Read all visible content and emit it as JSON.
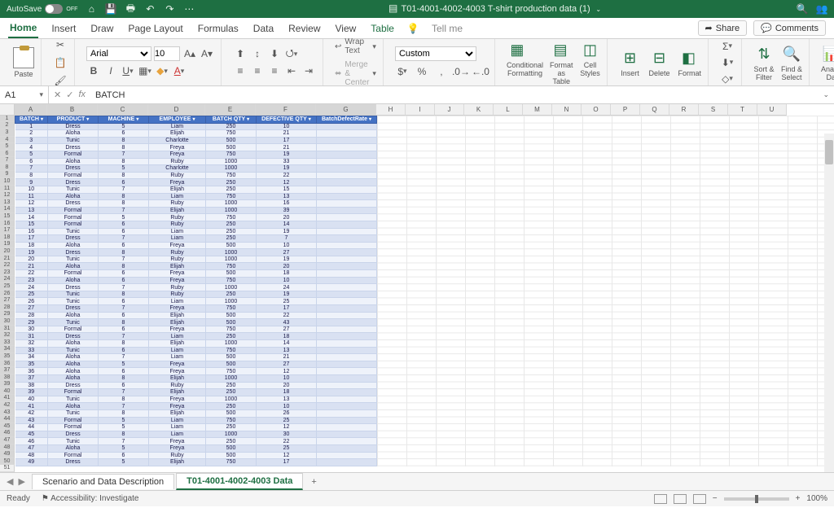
{
  "titlebar": {
    "autosave_label": "AutoSave",
    "autosave_state": "OFF",
    "filename": "T01-4001-4002-4003 T-shirt production data (1)"
  },
  "tabs": {
    "items": [
      "Home",
      "Insert",
      "Draw",
      "Page Layout",
      "Formulas",
      "Data",
      "Review",
      "View",
      "Table"
    ],
    "tell_me": "Tell me",
    "share": "Share",
    "comments": "Comments",
    "active": "Home"
  },
  "ribbon": {
    "paste": "Paste",
    "font_name": "Arial",
    "font_size": "10",
    "wrap_text": "Wrap Text",
    "merge_center": "Merge & Center",
    "number_format": "Custom",
    "cond_fmt": "Conditional Formatting",
    "fmt_table": "Format as Table",
    "cell_styles": "Cell Styles",
    "insert": "Insert",
    "delete": "Delete",
    "format": "Format",
    "sort_filter": "Sort & Filter",
    "find_select": "Find & Select",
    "analyze": "Analyze Data"
  },
  "formula_bar": {
    "name_box": "A1",
    "formula": "BATCH"
  },
  "columns": [
    "A",
    "B",
    "C",
    "D",
    "E",
    "F",
    "G",
    "H",
    "I",
    "J",
    "K",
    "L",
    "M",
    "N",
    "O",
    "P",
    "Q",
    "R",
    "S",
    "T",
    "U"
  ],
  "table": {
    "headers": [
      "BATCH",
      "PRODUCT",
      "MACHINE",
      "EMPLOYEE",
      "BATCH QTY",
      "DEFECTIVE QTY",
      "BatchDefectRate"
    ],
    "rows": [
      [
        1,
        "Dress",
        5,
        "Liam",
        250,
        10,
        ""
      ],
      [
        2,
        "Aloha",
        6,
        "Elijah",
        750,
        21,
        ""
      ],
      [
        3,
        "Tunic",
        8,
        "Charlotte",
        500,
        17,
        ""
      ],
      [
        4,
        "Dress",
        8,
        "Freya",
        500,
        21,
        ""
      ],
      [
        5,
        "Formal",
        7,
        "Freya",
        750,
        19,
        ""
      ],
      [
        6,
        "Aloha",
        8,
        "Ruby",
        1000,
        33,
        ""
      ],
      [
        7,
        "Dress",
        5,
        "Charlotte",
        1000,
        19,
        ""
      ],
      [
        8,
        "Formal",
        8,
        "Ruby",
        750,
        22,
        ""
      ],
      [
        9,
        "Dress",
        6,
        "Freya",
        250,
        12,
        ""
      ],
      [
        10,
        "Tunic",
        7,
        "Elijah",
        250,
        15,
        ""
      ],
      [
        11,
        "Aloha",
        8,
        "Liam",
        750,
        13,
        ""
      ],
      [
        12,
        "Dress",
        8,
        "Ruby",
        1000,
        16,
        ""
      ],
      [
        13,
        "Formal",
        7,
        "Elijah",
        1000,
        39,
        ""
      ],
      [
        14,
        "Formal",
        5,
        "Ruby",
        750,
        20,
        ""
      ],
      [
        15,
        "Formal",
        6,
        "Ruby",
        250,
        14,
        ""
      ],
      [
        16,
        "Tunic",
        6,
        "Liam",
        250,
        19,
        ""
      ],
      [
        17,
        "Dress",
        7,
        "Liam",
        250,
        7,
        ""
      ],
      [
        18,
        "Aloha",
        6,
        "Freya",
        500,
        10,
        ""
      ],
      [
        19,
        "Dress",
        8,
        "Ruby",
        1000,
        27,
        ""
      ],
      [
        20,
        "Tunic",
        7,
        "Ruby",
        1000,
        19,
        ""
      ],
      [
        21,
        "Aloha",
        8,
        "Elijah",
        750,
        20,
        ""
      ],
      [
        22,
        "Formal",
        6,
        "Freya",
        500,
        18,
        ""
      ],
      [
        23,
        "Aloha",
        6,
        "Freya",
        750,
        10,
        ""
      ],
      [
        24,
        "Dress",
        7,
        "Ruby",
        1000,
        24,
        ""
      ],
      [
        25,
        "Tunic",
        8,
        "Ruby",
        250,
        19,
        ""
      ],
      [
        26,
        "Tunic",
        6,
        "Liam",
        1000,
        25,
        ""
      ],
      [
        27,
        "Dress",
        7,
        "Freya",
        750,
        17,
        ""
      ],
      [
        28,
        "Aloha",
        6,
        "Elijah",
        500,
        22,
        ""
      ],
      [
        29,
        "Tunic",
        8,
        "Elijah",
        500,
        43,
        ""
      ],
      [
        30,
        "Formal",
        6,
        "Freya",
        750,
        27,
        ""
      ],
      [
        31,
        "Dress",
        7,
        "Liam",
        250,
        18,
        ""
      ],
      [
        32,
        "Aloha",
        8,
        "Elijah",
        1000,
        14,
        ""
      ],
      [
        33,
        "Tunic",
        6,
        "Liam",
        750,
        13,
        ""
      ],
      [
        34,
        "Aloha",
        7,
        "Liam",
        500,
        21,
        ""
      ],
      [
        35,
        "Aloha",
        5,
        "Freya",
        500,
        27,
        ""
      ],
      [
        36,
        "Aloha",
        6,
        "Freya",
        750,
        12,
        ""
      ],
      [
        37,
        "Aloha",
        8,
        "Elijah",
        1000,
        10,
        ""
      ],
      [
        38,
        "Dress",
        6,
        "Ruby",
        250,
        20,
        ""
      ],
      [
        39,
        "Formal",
        7,
        "Elijah",
        250,
        18,
        ""
      ],
      [
        40,
        "Tunic",
        8,
        "Freya",
        1000,
        13,
        ""
      ],
      [
        41,
        "Aloha",
        7,
        "Freya",
        250,
        10,
        ""
      ],
      [
        42,
        "Tunic",
        8,
        "Elijah",
        500,
        26,
        ""
      ],
      [
        43,
        "Formal",
        5,
        "Liam",
        750,
        25,
        ""
      ],
      [
        44,
        "Formal",
        5,
        "Liam",
        250,
        12,
        ""
      ],
      [
        45,
        "Dress",
        8,
        "Liam",
        1000,
        30,
        ""
      ],
      [
        46,
        "Tunic",
        7,
        "Freya",
        250,
        22,
        ""
      ],
      [
        47,
        "Aloha",
        5,
        "Freya",
        500,
        25,
        ""
      ],
      [
        48,
        "Formal",
        6,
        "Ruby",
        500,
        12,
        ""
      ],
      [
        49,
        "Dress",
        5,
        "Elijah",
        750,
        17,
        ""
      ]
    ]
  },
  "sheets": {
    "tabs": [
      "Scenario and Data Description",
      "T01-4001-4002-4003  Data"
    ],
    "active": 1
  },
  "status": {
    "ready": "Ready",
    "accessibility": "Accessibility: Investigate",
    "zoom": "100%"
  }
}
